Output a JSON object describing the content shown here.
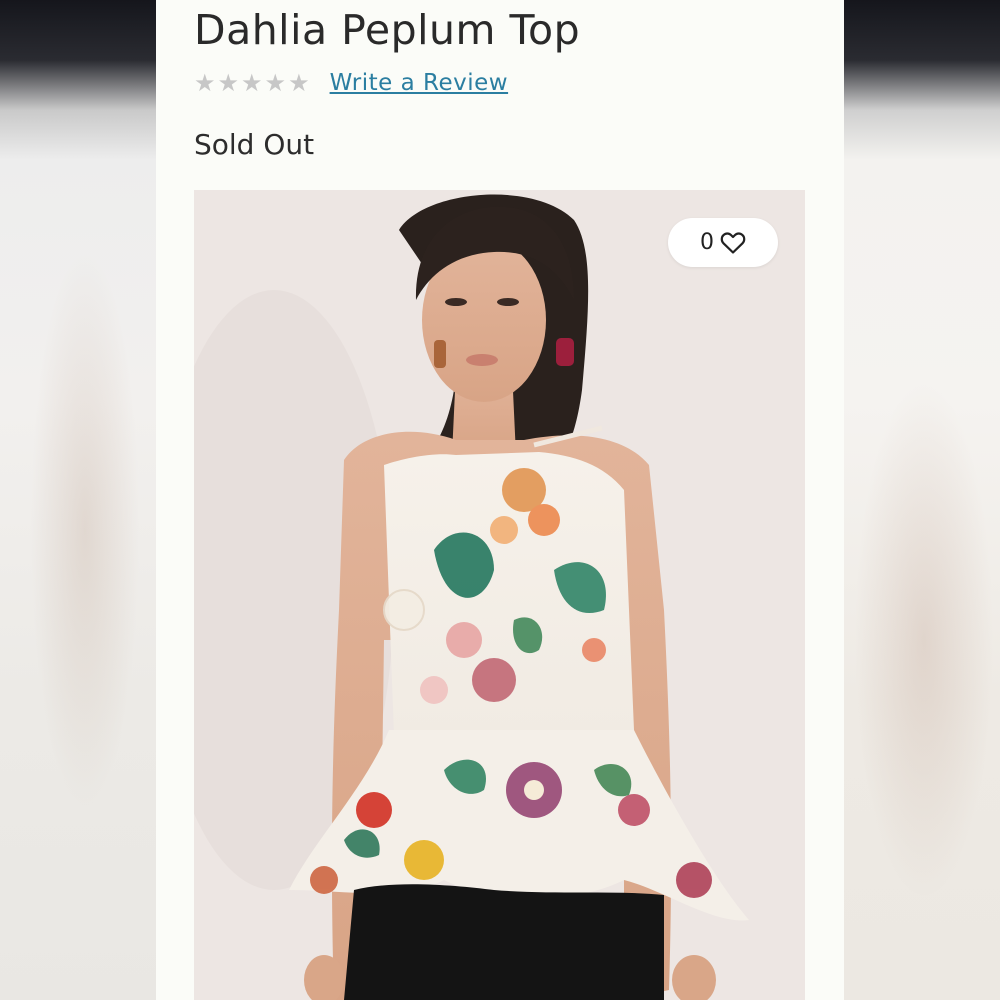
{
  "product": {
    "title": "Dahlia Peplum Top",
    "rating": {
      "stars": 5,
      "filled": 0
    },
    "review_link": "Write a Review",
    "status": "Sold Out"
  },
  "image": {
    "like_count": "0",
    "like_icon": "heart-outline-icon"
  },
  "colors": {
    "link": "#2b7ea1",
    "title": "#2a2a2a",
    "star_empty": "#c7c7c7"
  }
}
